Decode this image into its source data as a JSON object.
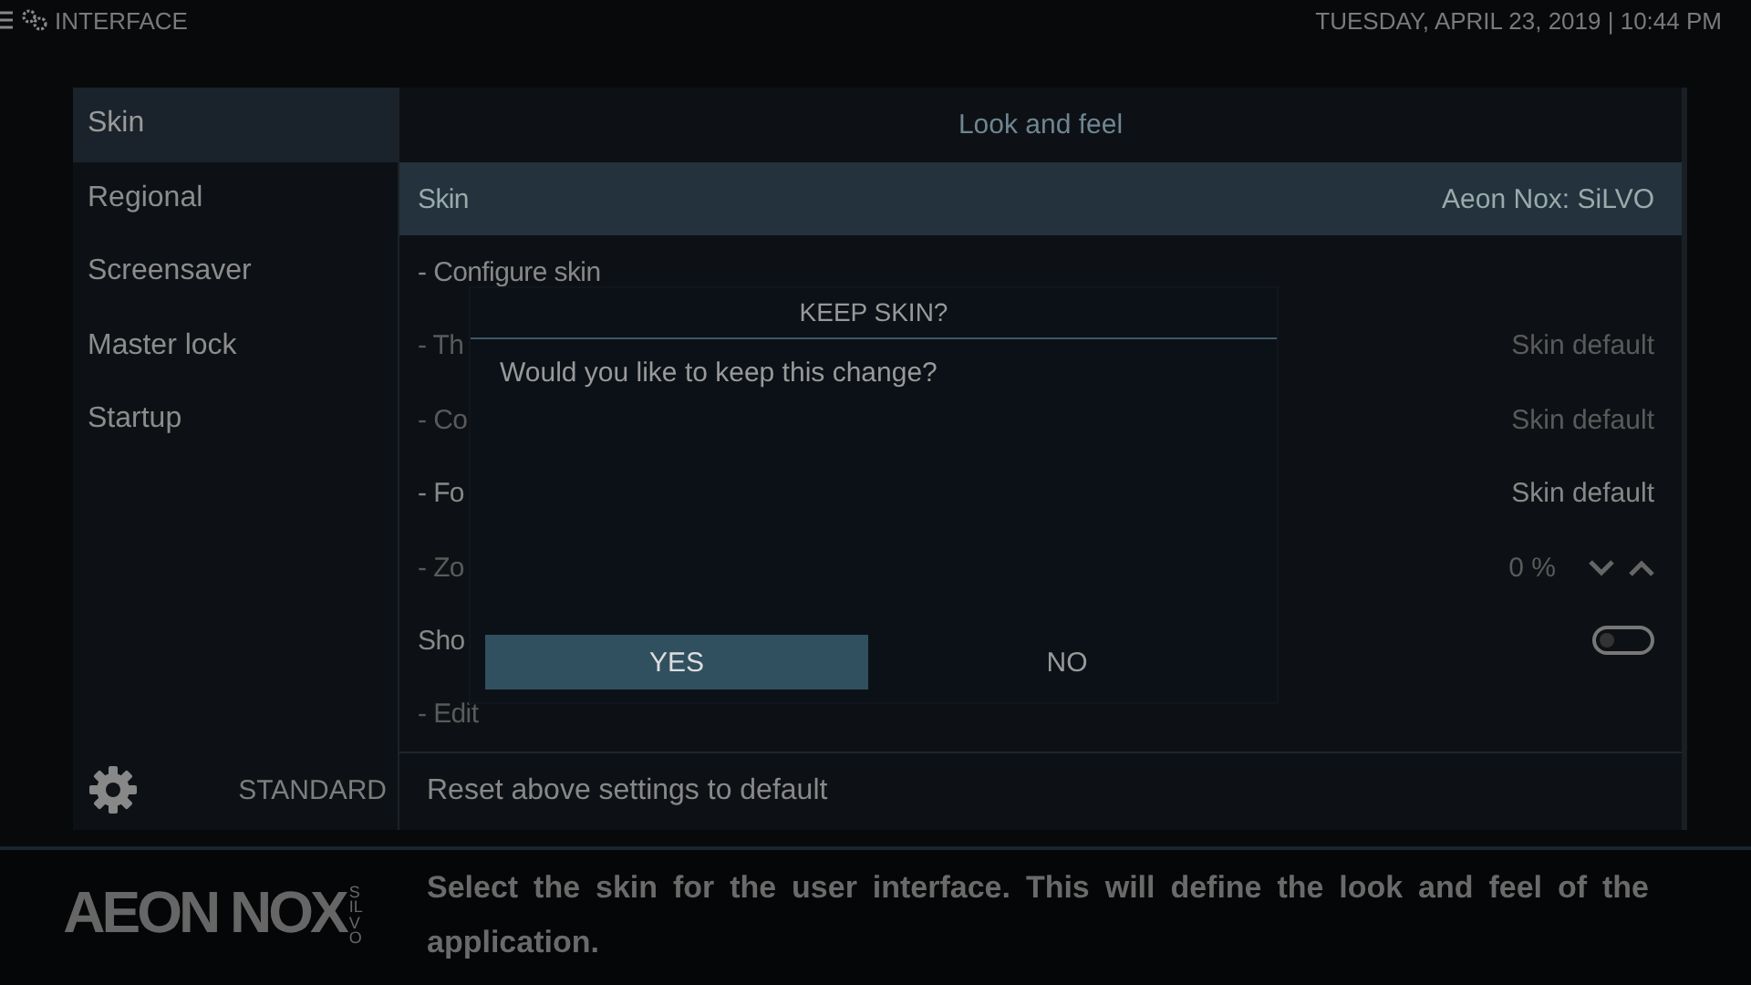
{
  "header": {
    "title": "INTERFACE",
    "datetime": "TUESDAY, APRIL 23, 2019 | 10:44 PM"
  },
  "sidebar": {
    "items": [
      {
        "label": "Skin",
        "selected": true
      },
      {
        "label": "Regional",
        "selected": false
      },
      {
        "label": "Screensaver",
        "selected": false
      },
      {
        "label": "Master lock",
        "selected": false
      },
      {
        "label": "Startup",
        "selected": false
      }
    ],
    "settings_level": "STANDARD"
  },
  "settings": {
    "group_title": "Look and feel",
    "rows": [
      {
        "label": "Skin",
        "value": "Aeon Nox: SiLVO",
        "kind": "text",
        "selected": true,
        "disabled": false
      },
      {
        "label": "- Configure skin",
        "kind": "none",
        "selected": false,
        "disabled": false
      },
      {
        "label": "- Th",
        "value": "Skin default",
        "kind": "text",
        "selected": false,
        "disabled": true
      },
      {
        "label": "- Co",
        "value": "Skin default",
        "kind": "text",
        "selected": false,
        "disabled": true
      },
      {
        "label": "- Fo",
        "value": "Skin default",
        "kind": "text",
        "selected": false,
        "disabled": false
      },
      {
        "label": "- Zo",
        "value": "0 %",
        "kind": "spinner",
        "selected": false,
        "disabled": true
      },
      {
        "label": "Sho",
        "kind": "toggle",
        "on": false,
        "selected": false,
        "disabled": false
      },
      {
        "label": "- Edit",
        "kind": "none",
        "selected": false,
        "disabled": true
      }
    ],
    "reset": "Reset above settings to default"
  },
  "dialog": {
    "title": "KEEP SKIN?",
    "message": "Would you like to keep this change?",
    "buttons": [
      {
        "label": "YES",
        "selected": true
      },
      {
        "label": "NO",
        "selected": false
      }
    ]
  },
  "footer": {
    "logo": "AEON NOX",
    "logo_sub": "SILVO",
    "description": "Select the skin for the user interface. This will define the look and feel of the application."
  }
}
